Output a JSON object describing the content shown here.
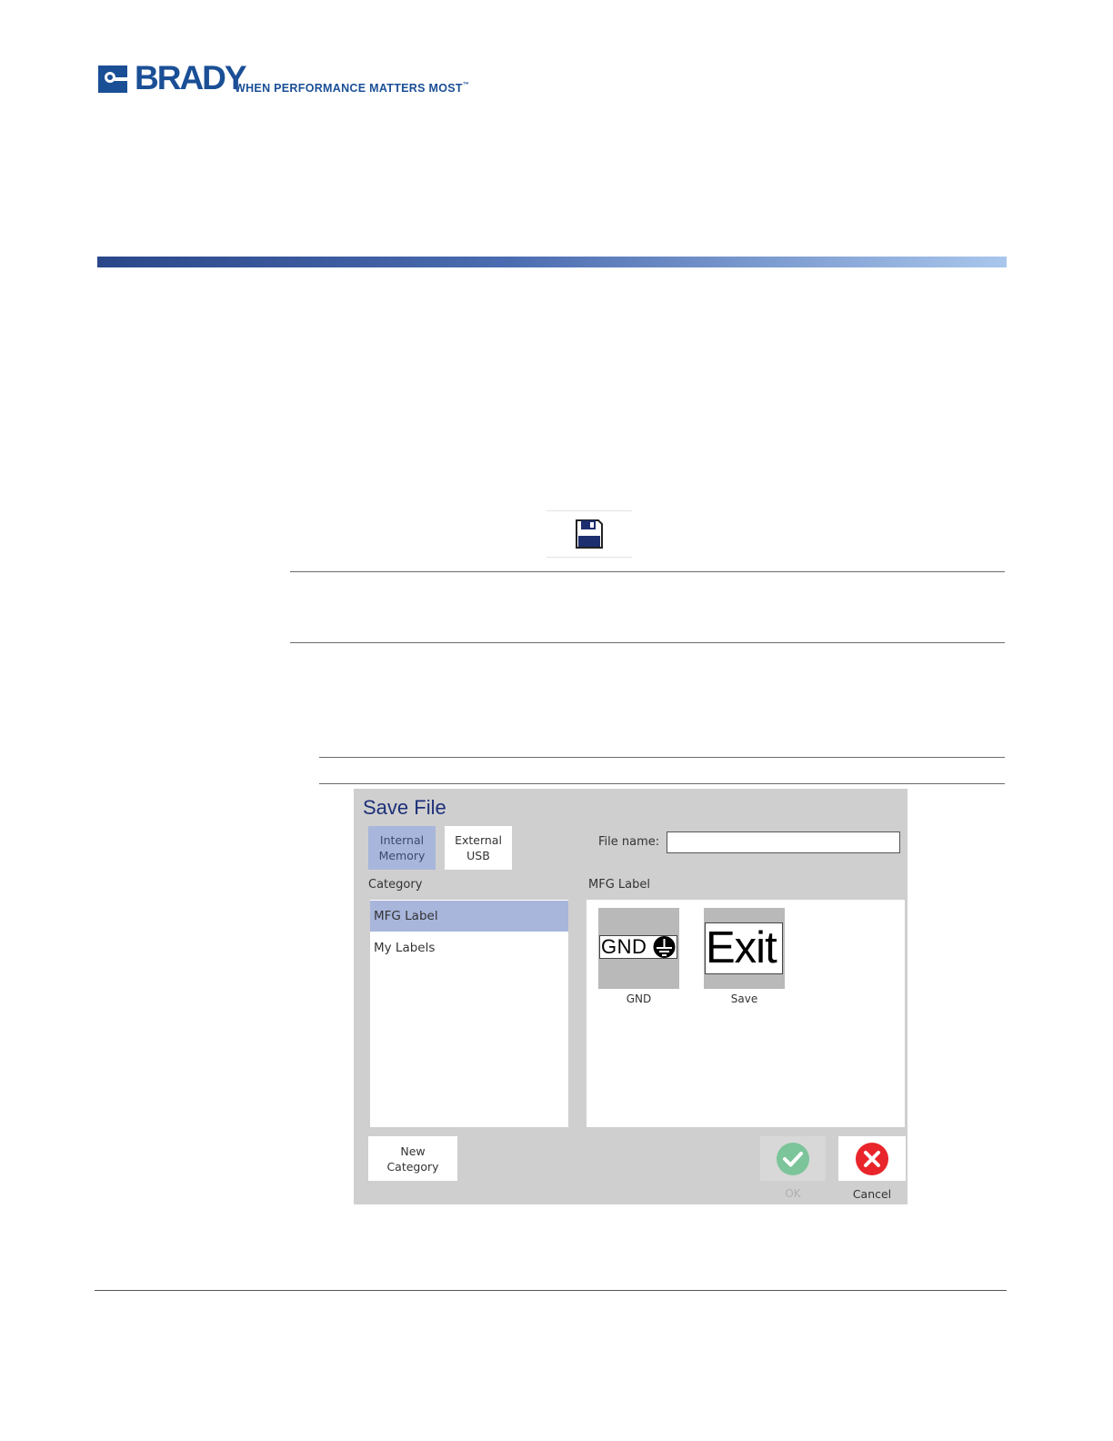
{
  "header": {
    "logo_word": "BRADY",
    "tagline": "WHEN PERFORMANCE MATTERS MOST",
    "tm": "™",
    "brand_color": "#1a4f96"
  },
  "save_icon": {
    "name": "floppy-disk-icon"
  },
  "dialog": {
    "title": "Save File",
    "storage": {
      "internal_line1": "Internal",
      "internal_line2": "Memory",
      "external_line1": "External",
      "external_line2": "USB",
      "selected": "Internal Memory"
    },
    "file_name_label": "File name:",
    "file_name_value": "",
    "category_header": "Category",
    "categories": [
      {
        "label": "MFG Label",
        "selected": true
      },
      {
        "label": "My Labels",
        "selected": false
      }
    ],
    "files_header": "MFG Label",
    "files": [
      {
        "caption": "GND",
        "thumb_text": "GND"
      },
      {
        "caption": "Save",
        "thumb_text": "Exit"
      }
    ],
    "new_category_line1": "New",
    "new_category_line2": "Category",
    "ok_label": "OK",
    "cancel_label": "Cancel",
    "colors": {
      "dialog_bg": "#cfcfcf",
      "selected_bg": "#a8b6dc",
      "title": "#1c2f78",
      "ok_green": "#7cc49a",
      "cancel_red": "#e8252a"
    }
  }
}
